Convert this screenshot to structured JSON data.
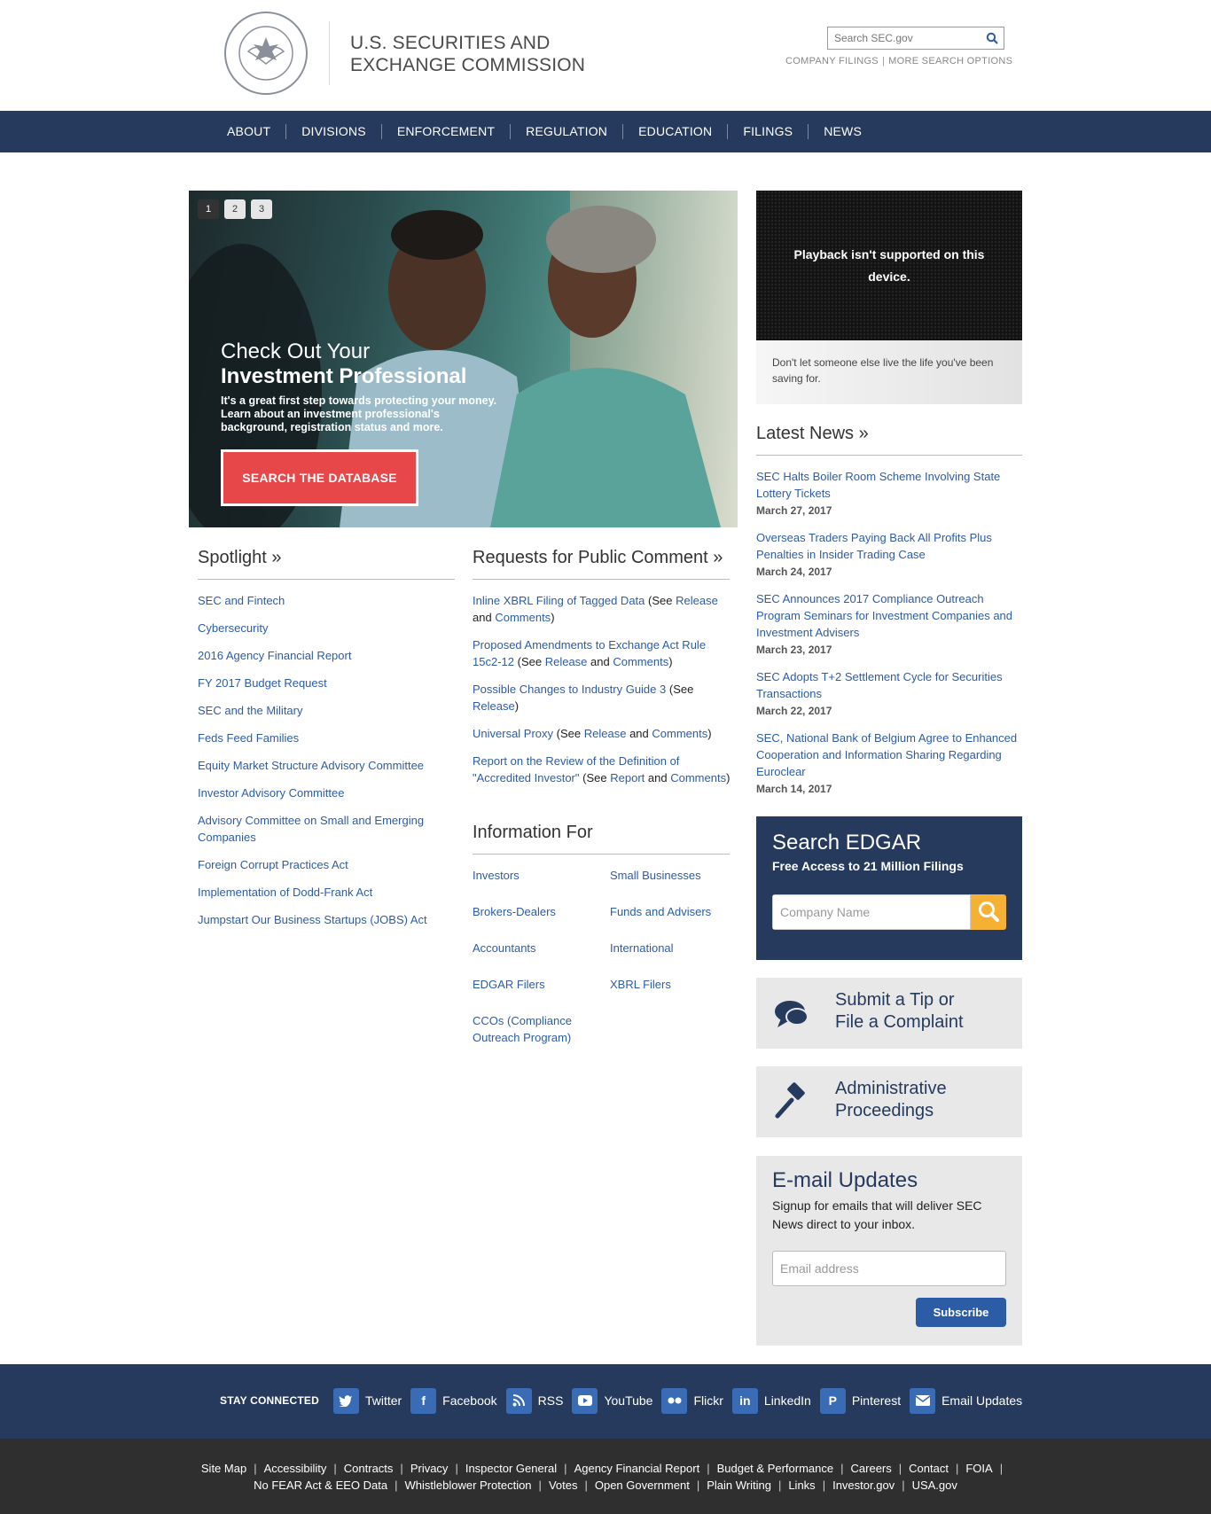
{
  "header": {
    "agency_line1": "U.S. SECURITIES AND",
    "agency_line2": "EXCHANGE COMMISSION",
    "search_placeholder": "Search SEC.gov",
    "company_filings": "COMPANY FILINGS",
    "more_search": "MORE SEARCH OPTIONS"
  },
  "nav": [
    "ABOUT",
    "DIVISIONS",
    "ENFORCEMENT",
    "REGULATION",
    "EDUCATION",
    "FILINGS",
    "NEWS"
  ],
  "hero": {
    "slides": [
      "1",
      "2",
      "3"
    ],
    "title_line1": "Check Out Your",
    "title_line2": "Investment Professional",
    "description": "It's a great first step towards protecting your money. Learn about an investment professional's background, registration status and more.",
    "button": "SEARCH THE DATABASE"
  },
  "video": {
    "message": "Playback isn't supported on this device.",
    "caption": "Don't let someone else live the life you've been saving for."
  },
  "latest_news": {
    "heading": "Latest News »",
    "items": [
      {
        "title": "SEC Halts Boiler Room Scheme Involving State Lottery Tickets",
        "date": "March 27, 2017"
      },
      {
        "title": "Overseas Traders Paying Back All Profits Plus Penalties in Insider Trading Case",
        "date": "March 24, 2017"
      },
      {
        "title": "SEC Announces 2017 Compliance Outreach Program Seminars for Investment Companies and Investment Advisers",
        "date": "March 23, 2017"
      },
      {
        "title": "SEC Adopts T+2 Settlement Cycle for Securities Transactions",
        "date": "March 22, 2017"
      },
      {
        "title": "SEC, National Bank of Belgium Agree to Enhanced Cooperation and Information Sharing Regarding Euroclear",
        "date": "March 14, 2017"
      }
    ]
  },
  "spotlight": {
    "heading": "Spotlight »",
    "items": [
      "SEC and Fintech",
      "Cybersecurity",
      "2016 Agency Financial Report",
      "FY 2017 Budget Request",
      "SEC and the Military",
      "Feds Feed Families",
      "Equity Market Structure Advisory Committee",
      "Investor Advisory Committee",
      "Advisory Committee on Small and Emerging Companies",
      "Foreign Corrupt Practices Act",
      "Implementation of Dodd-Frank Act",
      "Jumpstart Our Business Startups (JOBS) Act"
    ]
  },
  "requests": {
    "heading": "Requests for Public Comment »",
    "item1_link": "Inline XBRL Filing of Tagged Data",
    "item2_link": "Proposed Amendments to Exchange Act Rule 15c2-12",
    "item3_link": "Possible Changes to Industry Guide 3",
    "item4_link": "Universal Proxy",
    "item5_link": "Report on the Review of the Definition of \"Accredited Investor\"",
    "see_open": "(See",
    "and": "and",
    "close": ")",
    "release": "Release",
    "comments": "Comments",
    "report": "Report"
  },
  "information_for": {
    "heading": "Information For",
    "items": [
      "Investors",
      "Small Businesses",
      "Brokers-Dealers",
      "Funds and Advisers",
      "Accountants",
      "International",
      "EDGAR Filers",
      "XBRL Filers",
      "CCOs (Compliance Outreach Program)"
    ]
  },
  "edgar": {
    "title": "Search EDGAR",
    "subtitle": "Free Access to 21 Million Filings",
    "placeholder": "Company Name"
  },
  "tiles": {
    "tip_line1": "Submit a Tip or",
    "tip_line2": "File a Complaint",
    "admin_line1": "Administrative",
    "admin_line2": "Proceedings"
  },
  "email_updates": {
    "title": "E-mail Updates",
    "description": "Signup for emails that will deliver SEC News direct to your inbox.",
    "placeholder": "Email address",
    "button": "Subscribe"
  },
  "social": {
    "label": "STAY CONNECTED",
    "items": [
      {
        "label": "Twitter",
        "icon": "twitter-icon"
      },
      {
        "label": "Facebook",
        "icon": "facebook-icon"
      },
      {
        "label": "RSS",
        "icon": "rss-icon"
      },
      {
        "label": "YouTube",
        "icon": "youtube-icon"
      },
      {
        "label": "Flickr",
        "icon": "flickr-icon"
      },
      {
        "label": "LinkedIn",
        "icon": "linkedin-icon"
      },
      {
        "label": "Pinterest",
        "icon": "pinterest-icon"
      },
      {
        "label": "Email Updates",
        "icon": "envelope-icon"
      }
    ]
  },
  "footer": {
    "row1": [
      "Site Map",
      "Accessibility",
      "Contracts",
      "Privacy",
      "Inspector General",
      "Agency Financial Report",
      "Budget & Performance",
      "Careers",
      "Contact",
      "FOIA"
    ],
    "row2": [
      "No FEAR Act & EEO Data",
      "Whistleblower Protection",
      "Votes",
      "Open Government",
      "Plain Writing",
      "Links",
      "Investor.gov",
      "USA.gov"
    ]
  },
  "colors": {
    "navy": "#263a5e",
    "link_blue": "#2d5ca6",
    "hero_button": "#e8474a",
    "edgar_button": "#f5b134"
  }
}
